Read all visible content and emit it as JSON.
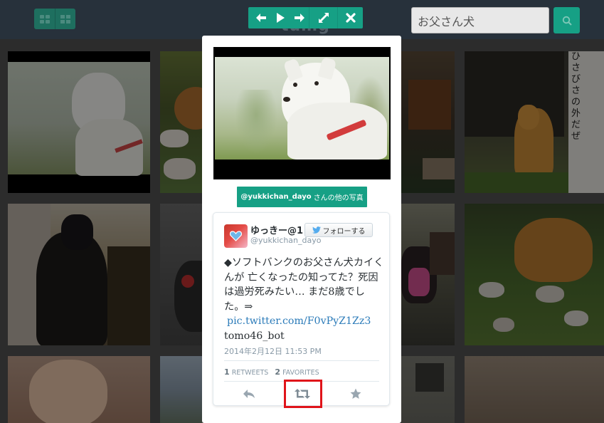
{
  "header": {
    "layout_icons": [
      "grid-view-icon",
      "list-view-icon"
    ],
    "logo_text": "tumg",
    "nav_icons": [
      "arrow-left-icon",
      "play-icon",
      "arrow-right-icon",
      "fullscreen-icon",
      "close-icon"
    ],
    "search": {
      "value": "お父さん犬",
      "icon": "search-icon"
    }
  },
  "modal": {
    "user_photos_button": {
      "username": "@yukkichan_dayo",
      "suffix": "さんの他の写真"
    },
    "tweet": {
      "display_name": "ゆっきー@1",
      "screen_name": "@yukkichan_dayo",
      "follow_label": "フォローする",
      "text_line1": "◆ソフトバンクのお父さん犬カイくんが 亡くなったの知ってた？死因は過労死みたい… まだ8歳でした。⇒",
      "link": "pic.twitter.com/F0vPyZ1Zz3",
      "text_line2": "tomo46_bot",
      "timestamp": "2014年2月12日 11:53 PM",
      "retweets_count": "1",
      "retweets_label": "RETWEETS",
      "favorites_count": "2",
      "favorites_label": "FAVORITES",
      "actions": [
        "reply-icon",
        "retweet-icon",
        "favorite-icon"
      ]
    }
  },
  "colors": {
    "accent": "#16a085",
    "topbar": "#27313b",
    "highlight": "#e0141a",
    "link": "#2b7bb9"
  }
}
